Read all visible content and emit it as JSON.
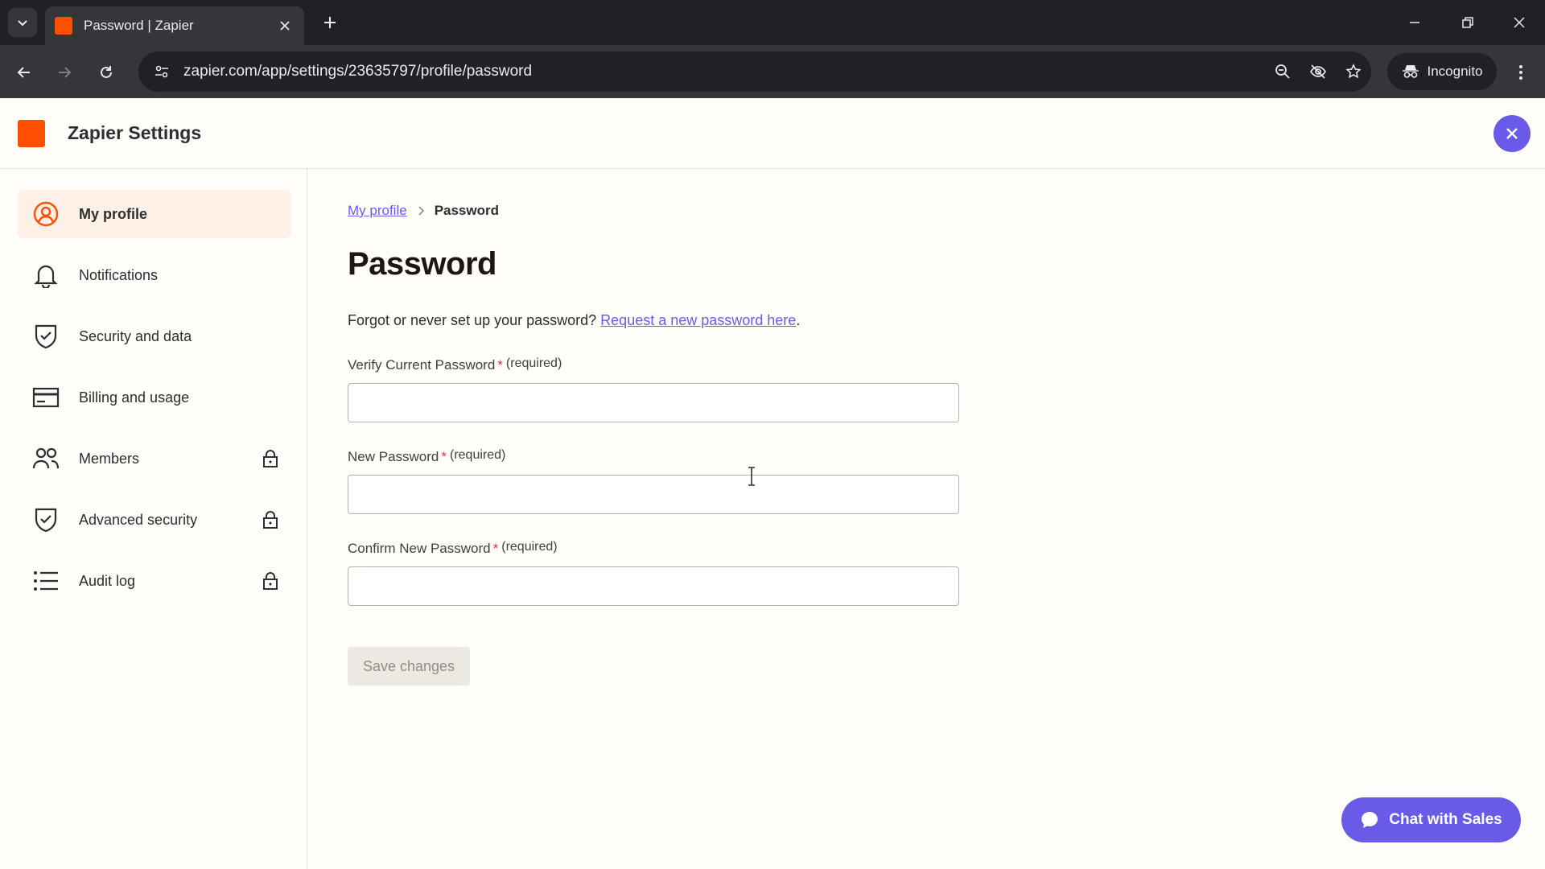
{
  "browser": {
    "tab_title": "Password | Zapier",
    "url": "zapier.com/app/settings/23635797/profile/password",
    "incognito_label": "Incognito"
  },
  "app": {
    "title": "Zapier Settings",
    "brand_color": "#ff4f00",
    "accent_color": "#695be8"
  },
  "sidebar": {
    "items": [
      {
        "label": "My profile",
        "icon": "user-circle-icon",
        "active": true,
        "locked": false
      },
      {
        "label": "Notifications",
        "icon": "bell-icon",
        "active": false,
        "locked": false
      },
      {
        "label": "Security and data",
        "icon": "shield-check-icon",
        "active": false,
        "locked": false
      },
      {
        "label": "Billing and usage",
        "icon": "credit-card-icon",
        "active": false,
        "locked": false
      },
      {
        "label": "Members",
        "icon": "users-icon",
        "active": false,
        "locked": true
      },
      {
        "label": "Advanced security",
        "icon": "shield-check-icon",
        "active": false,
        "locked": true
      },
      {
        "label": "Audit log",
        "icon": "list-icon",
        "active": false,
        "locked": true
      }
    ]
  },
  "main": {
    "breadcrumb": {
      "parent": "My profile",
      "current": "Password"
    },
    "title": "Password",
    "forgot_text": "Forgot or never set up your password?",
    "forgot_link": "Request a new password here",
    "forgot_suffix": ".",
    "fields": [
      {
        "label": "Verify Current Password",
        "required_mark": "*",
        "required_text": "(required)",
        "value": ""
      },
      {
        "label": "New Password",
        "required_mark": "*",
        "required_text": "(required)",
        "value": ""
      },
      {
        "label": "Confirm New Password",
        "required_mark": "*",
        "required_text": "(required)",
        "value": ""
      }
    ],
    "save_label": "Save changes"
  },
  "chat": {
    "label": "Chat with Sales"
  }
}
